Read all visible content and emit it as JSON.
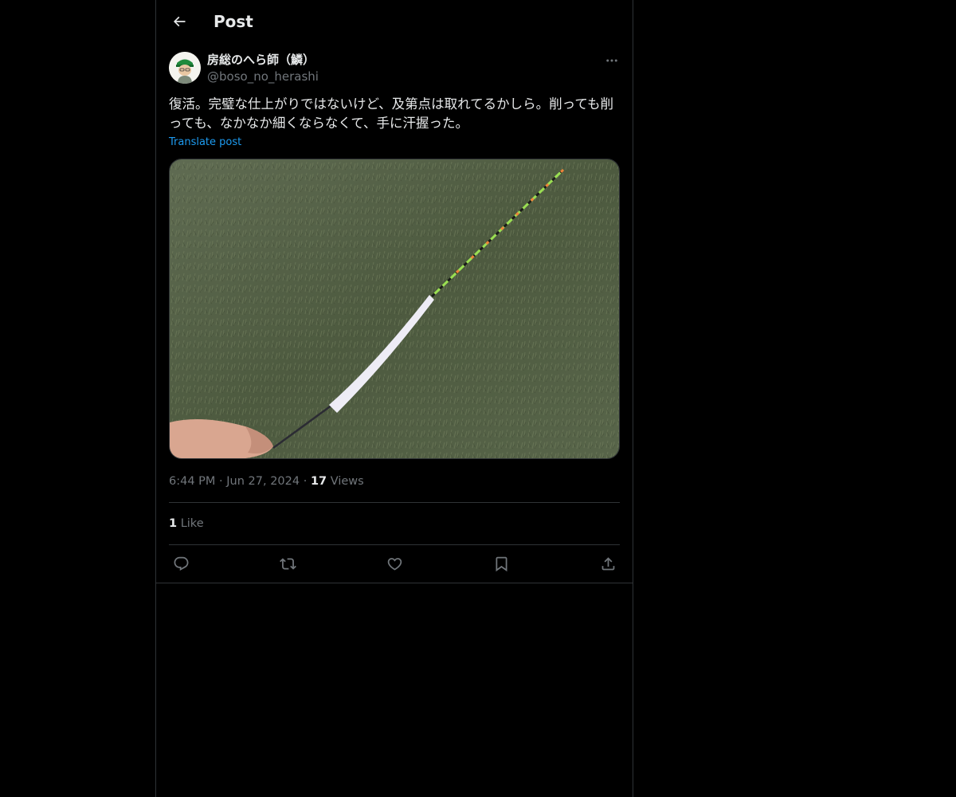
{
  "header": {
    "title": "Post",
    "back_icon": "arrow-left-icon"
  },
  "post": {
    "author": {
      "display_name": "房総のへら師（鱗）",
      "handle": "@boso_no_herashi"
    },
    "text": "復活。完璧な仕上がりではないけど、及第点は取れてるかしら。削っても削っても、なかなか細くならなくて、手に汗握った。",
    "translate_label": "Translate post",
    "timestamp_time": "6:44 PM",
    "timestamp_date": "Jun 27, 2024",
    "separator": "·",
    "views_count": "17",
    "views_label": "Views",
    "likes_count": "1",
    "likes_label": "Like"
  },
  "actions": {
    "icons": [
      "reply-icon",
      "repost-icon",
      "like-icon",
      "bookmark-icon",
      "share-icon"
    ]
  },
  "colors": {
    "background": "#000000",
    "text_primary": "#e7e9ea",
    "text_secondary": "#71767b",
    "accent": "#1d9bf0",
    "border": "#2f3336"
  }
}
